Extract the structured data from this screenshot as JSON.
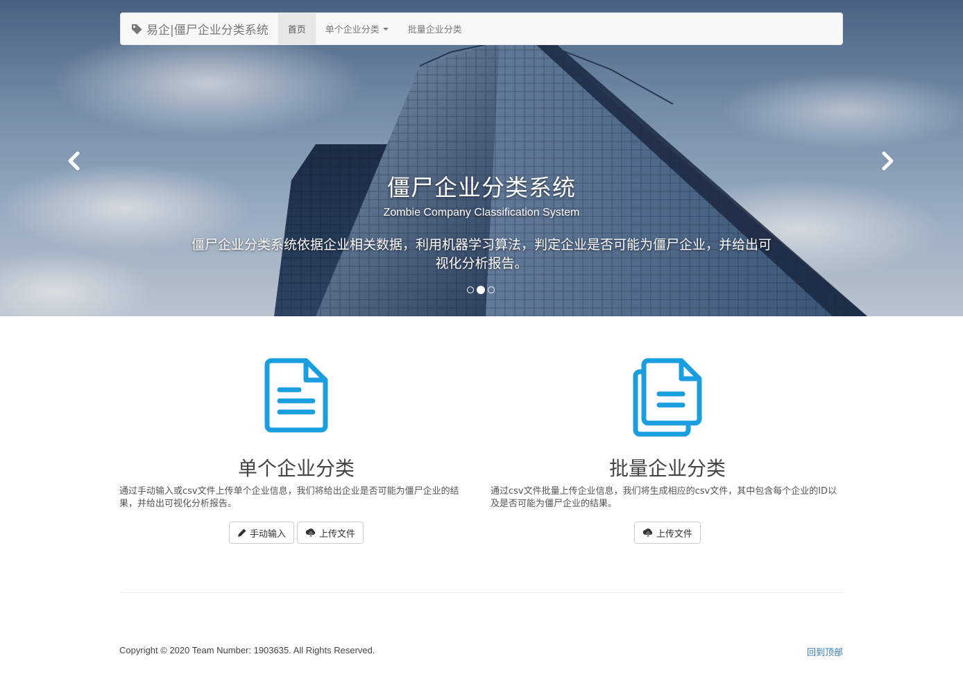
{
  "navbar": {
    "brand": "易企|僵尸企业分类系统",
    "items": [
      {
        "label": "首页",
        "active": true
      },
      {
        "label": "单个企业分类",
        "dropdown": true
      },
      {
        "label": "批量企业分类"
      }
    ]
  },
  "hero": {
    "title": "僵尸企业分类系统",
    "subtitle": "Zombie Company Classification System",
    "description": "僵尸企业分类系统依据企业相关数据，利用机器学习算法，判定企业是否可能为僵尸企业，并给出可视化分析报告。",
    "slides": 3,
    "active_slide": 1
  },
  "features": {
    "single": {
      "icon": "document-icon",
      "title": "单个企业分类",
      "text": "通过手动输入或csv文件上传单个企业信息，我们将给出企业是否可能为僵尸企业的结果，并给出可视化分析报告。",
      "buttons": {
        "manual": "手动输入",
        "upload": "上传文件"
      }
    },
    "batch": {
      "icon": "documents-icon",
      "title": "批量企业分类",
      "text": "通过csv文件批量上传企业信息，我们将生成相应的csv文件，其中包含每个企业的ID以及是否可能为僵尸企业的结果。",
      "buttons": {
        "upload": "上传文件"
      }
    }
  },
  "footer": {
    "copyright": "Copyright © 2020 Team Number: 1903635. All Rights Reserved.",
    "back_to_top": "回到顶部"
  },
  "colors": {
    "accent": "#1a9ee0",
    "link": "#337ab7"
  }
}
